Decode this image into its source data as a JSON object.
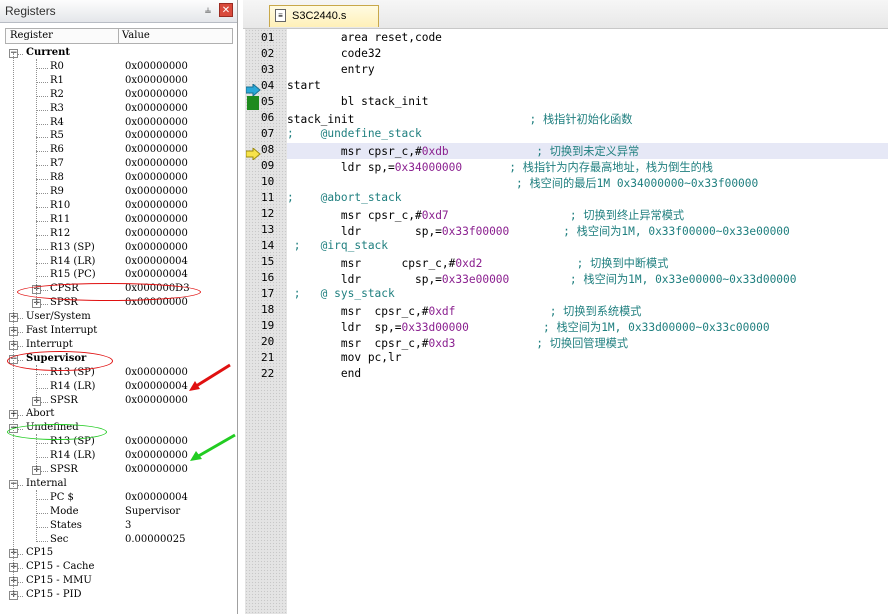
{
  "registers_panel": {
    "title": "Registers",
    "pin_icon": "pin-icon",
    "close_icon": "close-icon",
    "columns": {
      "register": "Register",
      "value": "Value"
    },
    "rows": [
      {
        "label": "Current",
        "value": "",
        "bold": true,
        "expander": "-",
        "indent": 0
      },
      {
        "label": "R0",
        "value": "0x00000000",
        "indent": 1
      },
      {
        "label": "R1",
        "value": "0x00000000",
        "indent": 1
      },
      {
        "label": "R2",
        "value": "0x00000000",
        "indent": 1
      },
      {
        "label": "R3",
        "value": "0x00000000",
        "indent": 1
      },
      {
        "label": "R4",
        "value": "0x00000000",
        "indent": 1
      },
      {
        "label": "R5",
        "value": "0x00000000",
        "indent": 1
      },
      {
        "label": "R6",
        "value": "0x00000000",
        "indent": 1
      },
      {
        "label": "R7",
        "value": "0x00000000",
        "indent": 1
      },
      {
        "label": "R8",
        "value": "0x00000000",
        "indent": 1
      },
      {
        "label": "R9",
        "value": "0x00000000",
        "indent": 1
      },
      {
        "label": "R10",
        "value": "0x00000000",
        "indent": 1
      },
      {
        "label": "R11",
        "value": "0x00000000",
        "indent": 1
      },
      {
        "label": "R12",
        "value": "0x00000000",
        "indent": 1
      },
      {
        "label": "R13 (SP)",
        "value": "0x00000000",
        "indent": 1
      },
      {
        "label": "R14 (LR)",
        "value": "0x00000004",
        "indent": 1
      },
      {
        "label": "R15 (PC)",
        "value": "0x00000004",
        "indent": 1
      },
      {
        "label": "CPSR",
        "value": "0x000000D3",
        "indent": 1,
        "expander": "+"
      },
      {
        "label": "SPSR",
        "value": "0x00000000",
        "indent": 1,
        "expander": "+"
      },
      {
        "label": "User/System",
        "value": "",
        "expander": "+",
        "indent": 0
      },
      {
        "label": "Fast Interrupt",
        "value": "",
        "expander": "+",
        "indent": 0
      },
      {
        "label": "Interrupt",
        "value": "",
        "expander": "+",
        "indent": 0
      },
      {
        "label": "Supervisor",
        "value": "",
        "bold": true,
        "expander": "-",
        "indent": 0
      },
      {
        "label": "R13 (SP)",
        "value": "0x00000000",
        "indent": 1
      },
      {
        "label": "R14 (LR)",
        "value": "0x00000004",
        "indent": 1
      },
      {
        "label": "SPSR",
        "value": "0x00000000",
        "indent": 1,
        "expander": "+"
      },
      {
        "label": "Abort",
        "value": "",
        "expander": "+",
        "indent": 0
      },
      {
        "label": "Undefined",
        "value": "",
        "expander": "-",
        "indent": 0
      },
      {
        "label": "R13 (SP)",
        "value": "0x00000000",
        "indent": 1
      },
      {
        "label": "R14 (LR)",
        "value": "0x00000000",
        "indent": 1
      },
      {
        "label": "SPSR",
        "value": "0x00000000",
        "indent": 1,
        "expander": "+"
      },
      {
        "label": "Internal",
        "value": "",
        "expander": "-",
        "indent": 0
      },
      {
        "label": "PC  $",
        "value": "0x00000004",
        "indent": 1
      },
      {
        "label": "Mode",
        "value": "Supervisor",
        "indent": 1
      },
      {
        "label": "States",
        "value": "3",
        "indent": 1
      },
      {
        "label": "Sec",
        "value": "0.00000025",
        "indent": 1
      },
      {
        "label": "CP15",
        "value": "",
        "expander": "+",
        "indent": 0
      },
      {
        "label": "CP15 - Cache",
        "value": "",
        "expander": "+",
        "indent": 0
      },
      {
        "label": "CP15 - MMU",
        "value": "",
        "expander": "+",
        "indent": 0
      },
      {
        "label": "CP15 - PID",
        "value": "",
        "expander": "+",
        "indent": 0
      }
    ]
  },
  "annotations": {
    "red_color": "#e01010",
    "green_color": "#22cc22"
  },
  "editor": {
    "tab_label": "S3C2440.s",
    "tab_icon": "asm-file-icon",
    "highlight_color": "#e6e8f6",
    "lines": [
      {
        "n": "01",
        "parts": [
          [
            "        area reset,code",
            ""
          ]
        ]
      },
      {
        "n": "02",
        "parts": [
          [
            "        code32",
            ""
          ]
        ]
      },
      {
        "n": "03",
        "parts": [
          [
            "        entry",
            ""
          ]
        ]
      },
      {
        "n": "04",
        "parts": [
          [
            "start",
            ""
          ]
        ],
        "marker": "pc-arrow"
      },
      {
        "n": "05",
        "parts": [
          [
            "        bl stack_init",
            ""
          ]
        ],
        "marker": "breakpoint"
      },
      {
        "n": "06",
        "parts": [
          [
            "stack_init                          ",
            ""
          ],
          [
            "; 栈指针初始化函数",
            "cmt"
          ]
        ]
      },
      {
        "n": "07",
        "parts": [
          [
            ";    @undefine_stack",
            "cmt"
          ]
        ]
      },
      {
        "n": "08",
        "parts": [
          [
            "        msr cpsr_c,#",
            ""
          ],
          [
            "0xdb",
            "num"
          ],
          [
            "             ",
            ""
          ],
          [
            "; 切换到未定义异常",
            "cmt"
          ]
        ],
        "marker": "current-arrow",
        "highlight": true
      },
      {
        "n": "09",
        "parts": [
          [
            "        ldr sp,=",
            ""
          ],
          [
            "0x34000000",
            "num"
          ],
          [
            "       ",
            ""
          ],
          [
            "; 栈指针为内存最高地址，栈为倒生的栈",
            "cmt"
          ]
        ]
      },
      {
        "n": "10",
        "parts": [
          [
            "                                  ",
            ""
          ],
          [
            "; 栈空间的最后1M 0x34000000~0x33f00000",
            "cmt"
          ]
        ]
      },
      {
        "n": "11",
        "parts": [
          [
            ";    @abort_stack",
            "cmt"
          ]
        ]
      },
      {
        "n": "12",
        "parts": [
          [
            "        msr cpsr_c,#",
            ""
          ],
          [
            "0xd7",
            "num"
          ],
          [
            "                  ",
            ""
          ],
          [
            "; 切换到终止异常模式",
            "cmt"
          ]
        ]
      },
      {
        "n": "13",
        "parts": [
          [
            "        ldr        sp,=",
            ""
          ],
          [
            "0x33f00000",
            "num"
          ],
          [
            "        ",
            ""
          ],
          [
            "; 栈空间为1M, 0x33f00000~0x33e00000",
            "cmt"
          ]
        ]
      },
      {
        "n": "14",
        "parts": [
          [
            " ;   @irq_stack",
            "cmt"
          ]
        ]
      },
      {
        "n": "15",
        "parts": [
          [
            "        msr      cpsr_c,#",
            ""
          ],
          [
            "0xd2",
            "num"
          ],
          [
            "              ",
            ""
          ],
          [
            "; 切换到中断模式",
            "cmt"
          ]
        ]
      },
      {
        "n": "16",
        "parts": [
          [
            "        ldr        sp,=",
            ""
          ],
          [
            "0x33e00000",
            "num"
          ],
          [
            "         ",
            ""
          ],
          [
            "; 栈空间为1M, 0x33e00000~0x33d00000",
            "cmt"
          ]
        ]
      },
      {
        "n": "17",
        "parts": [
          [
            " ;   @ sys_stack",
            "cmt"
          ]
        ]
      },
      {
        "n": "18",
        "parts": [
          [
            "        msr  cpsr_c,#",
            ""
          ],
          [
            "0xdf",
            "num"
          ],
          [
            "              ",
            ""
          ],
          [
            "; 切换到系统模式",
            "cmt"
          ]
        ]
      },
      {
        "n": "19",
        "parts": [
          [
            "        ldr  sp,=",
            ""
          ],
          [
            "0x33d00000",
            "num"
          ],
          [
            "           ",
            ""
          ],
          [
            "; 栈空间为1M, 0x33d00000~0x33c00000",
            "cmt"
          ]
        ]
      },
      {
        "n": "20",
        "parts": [
          [
            "        msr  cpsr_c,#",
            ""
          ],
          [
            "0xd3",
            "num"
          ],
          [
            "            ",
            ""
          ],
          [
            "; 切换回管理模式",
            "cmt"
          ]
        ]
      },
      {
        "n": "21",
        "parts": [
          [
            "        mov pc,lr",
            ""
          ]
        ]
      },
      {
        "n": "22",
        "parts": [
          [
            "        end",
            ""
          ]
        ]
      }
    ]
  }
}
